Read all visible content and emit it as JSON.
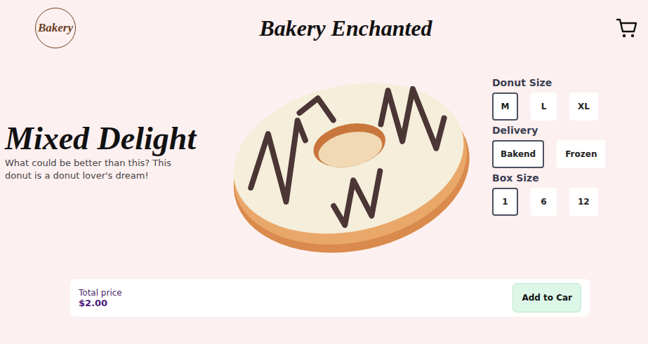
{
  "header": {
    "logo": "Bakery",
    "title": "Bakery Enchanted"
  },
  "product": {
    "name": "Mixed Delight",
    "description": "What could be better than this? This donut is a donut lover's dream!"
  },
  "options": [
    {
      "label": "Donut Size",
      "choices": [
        {
          "label": "M",
          "selected": true
        },
        {
          "label": "L",
          "selected": false
        },
        {
          "label": "XL",
          "selected": false
        }
      ]
    },
    {
      "label": "Delivery",
      "choices": [
        {
          "label": "Bakend",
          "selected": true
        },
        {
          "label": "Frozen",
          "selected": false
        }
      ]
    },
    {
      "label": "Box Size",
      "choices": [
        {
          "label": "1",
          "selected": true
        },
        {
          "label": "6",
          "selected": false
        },
        {
          "label": "12",
          "selected": false
        }
      ]
    }
  ],
  "footer": {
    "price_label": "Total price",
    "price": "$2.00",
    "button": "Add to Car"
  }
}
